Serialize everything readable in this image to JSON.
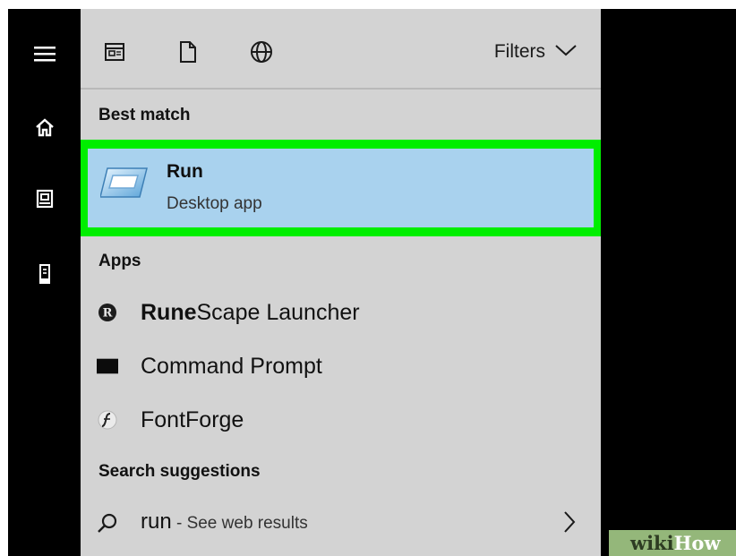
{
  "sidebar": {
    "icons": [
      "hamburger-menu-icon",
      "home-icon",
      "documents-icon",
      "device-icon"
    ]
  },
  "toolbar": {
    "icons": [
      "apps-icon",
      "document-icon",
      "globe-icon"
    ],
    "filters_label": "Filters"
  },
  "best_match": {
    "section_label": "Best match",
    "title": "Run",
    "subtitle": "Desktop app",
    "icon": "run-icon",
    "highlight_color": "#00ee00"
  },
  "apps": {
    "section_label": "Apps",
    "items": [
      {
        "bold": "Rune",
        "rest": "Scape Launcher",
        "icon": "runescape-icon"
      },
      {
        "bold": "",
        "rest": "Command Prompt",
        "icon": "command-prompt-icon"
      },
      {
        "bold": "",
        "rest": "FontForge",
        "icon": "fontforge-icon"
      }
    ]
  },
  "search_suggestions": {
    "section_label": "Search suggestions",
    "query": "run",
    "hint": " - See web results"
  },
  "watermark": {
    "part1": "wiki",
    "part2": "How"
  }
}
